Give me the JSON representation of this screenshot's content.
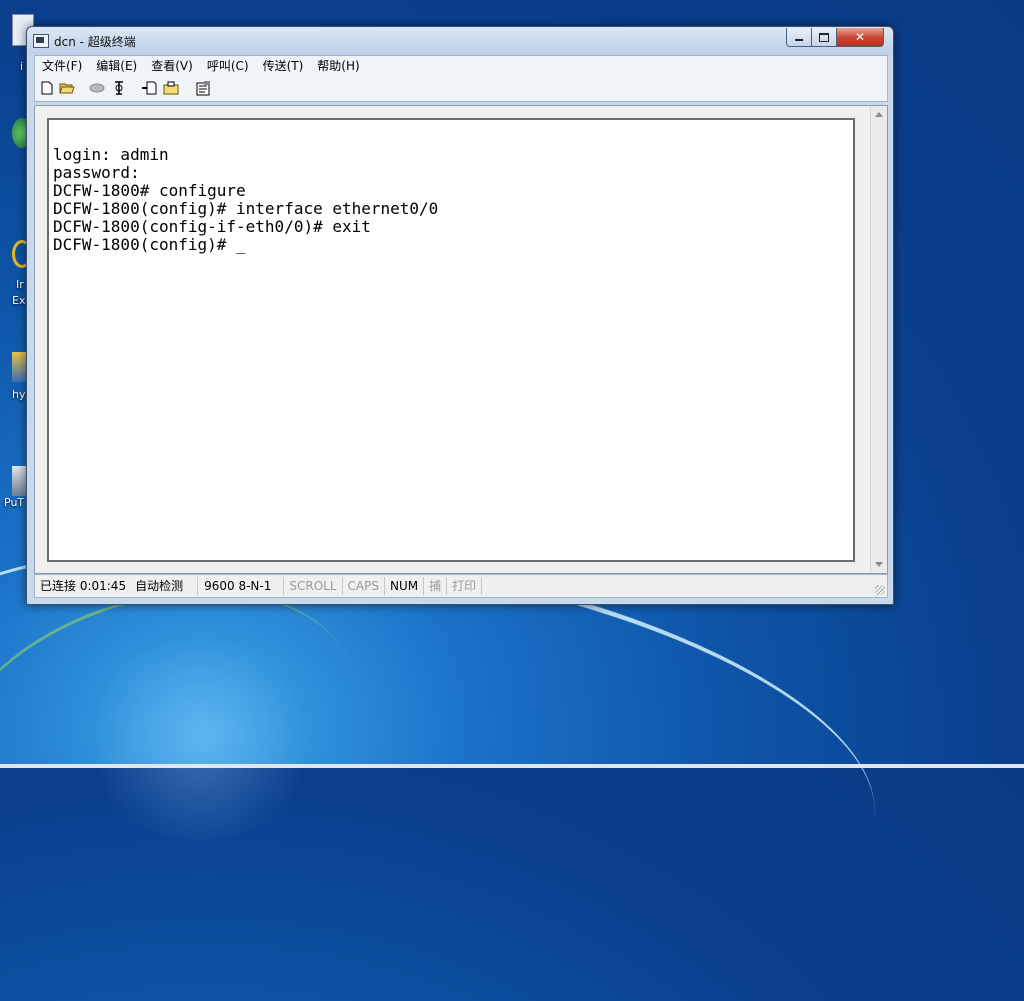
{
  "window": {
    "title": "dcn - 超级终端"
  },
  "menu": [
    "文件(F)",
    "编辑(E)",
    "查看(V)",
    "呼叫(C)",
    "传送(T)",
    "帮助(H)"
  ],
  "toolbar": [
    "new-icon",
    "open-icon",
    "disconnect-icon",
    "call-icon",
    "send-icon",
    "receive-icon",
    "properties-icon"
  ],
  "terminal": {
    "lines": [
      "login: admin",
      "password:",
      "DCFW-1800# configure",
      "DCFW-1800(config)# interface ethernet0/0",
      "DCFW-1800(config-if-eth0/0)# exit",
      "DCFW-1800(config)# _"
    ]
  },
  "status": {
    "connection": "已连接 0:01:45",
    "detect": "自动检测",
    "baud": "9600 8-N-1",
    "scroll": "SCROLL",
    "caps": "CAPS",
    "num": "NUM",
    "capture": "捕",
    "print": "打印"
  },
  "desktop": {
    "labels": [
      "i",
      "Ir",
      "Ex",
      "hy",
      "PuT"
    ]
  }
}
